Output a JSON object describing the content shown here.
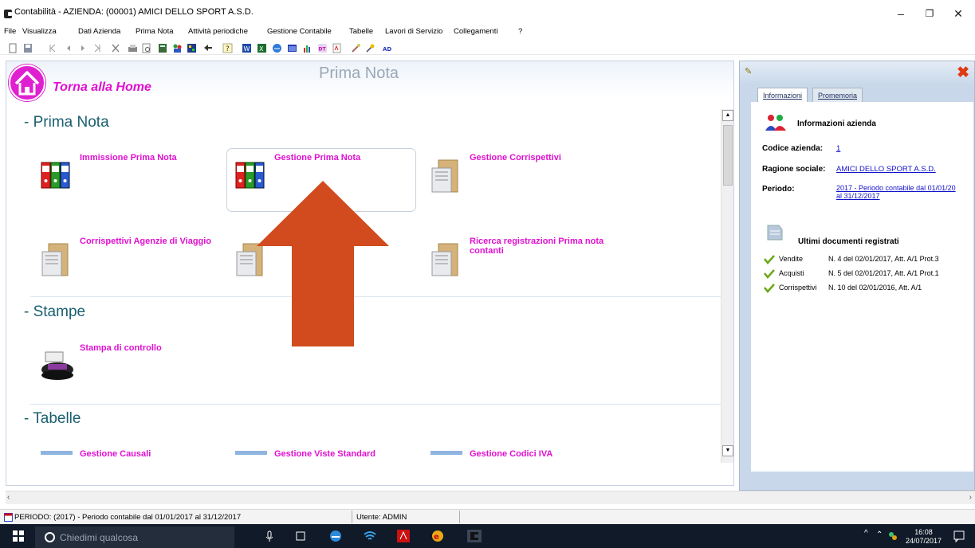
{
  "window": {
    "title": "Contabilità - AZIENDA: (00001) AMICI DELLO SPORT A.S.D.",
    "minimize_label": "–",
    "maximize_label": "❐",
    "close_label": "✕"
  },
  "menu": [
    "File",
    "Visualizza",
    "Dati Azienda",
    "Prima Nota",
    "Attività periodiche",
    "Gestione Contabile",
    "Tabelle",
    "Lavori di Servizio",
    "Collegamenti",
    "?"
  ],
  "toolbar": {
    "icons": [
      "new-icon",
      "save-icon",
      "first-record-icon",
      "prev-record-icon",
      "next-record-icon",
      "last-record-icon",
      "delete-icon",
      "print-icon",
      "print-preview-icon",
      "calculator-icon",
      "users-icon",
      "grid-icon",
      "pointer-icon",
      "help-icon",
      "word-icon",
      "excel-icon",
      "browser-icon",
      "window-icon",
      "chart-icon",
      "dt-icon",
      "pdf-icon",
      "tools-icon",
      "wizard-icon",
      "ad-icon"
    ],
    "ad_label": "AD",
    "dt_label": "DT"
  },
  "home": {
    "label": "Torna alla Home"
  },
  "page_title": "Prima Nota",
  "sections": [
    {
      "title": "- Prima Nota",
      "tiles": [
        {
          "label": "Immissione Prima Nota",
          "icon": "binders-icon"
        },
        {
          "label": "Gestione Prima Nota",
          "icon": "binders-icon",
          "selected": true
        },
        {
          "label": "Gestione Corrispettivi",
          "icon": "folder-icon"
        },
        {
          "label": "Corrispettivi Agenzie di Viaggio",
          "icon": "folder-icon"
        },
        {
          "label": "",
          "icon": "folder-icon"
        },
        {
          "label": "Ricerca registrazioni Prima nota contanti",
          "icon": "folder-icon"
        }
      ]
    },
    {
      "title": "- Stampe",
      "tiles": [
        {
          "label": "Stampa di controllo",
          "icon": "printer-icon"
        }
      ]
    },
    {
      "title": "- Tabelle",
      "tiles": [
        {
          "label": "Gestione Causali",
          "icon": "table-icon"
        },
        {
          "label": "Gestione Viste Standard",
          "icon": "table-icon"
        },
        {
          "label": "Gestione Codici IVA",
          "icon": "table-icon"
        }
      ]
    }
  ],
  "panel": {
    "tabs": [
      "Informazioni",
      "Promemoria"
    ],
    "info_title": "Informazioni azienda",
    "codice_label": "Codice azienda:",
    "codice_value": "1",
    "ragione_label": "Ragione sociale:",
    "ragione_value": "AMICI DELLO SPORT A.S.D.",
    "periodo_label": "Periodo:",
    "periodo_line1": "2017 - Periodo contabile dal 01/01/20",
    "periodo_line2": "al 31/12/2017",
    "docs_title": "Ultimi documenti registrati",
    "docs": [
      {
        "type": "Vendite",
        "desc": "N. 4 del 02/01/2017, Att. A/1 Prot.3"
      },
      {
        "type": "Acquisti",
        "desc": "N. 5 del 02/01/2017, Att. A/1 Prot.1"
      },
      {
        "type": "Corrispettivi",
        "desc": "N. 10 del 02/01/2016, Att. A/1"
      }
    ]
  },
  "statusbar": {
    "period": "PERIODO: (2017)  - Periodo contabile dal 01/01/2017 al 31/12/2017",
    "user": "Utente: ADMIN"
  },
  "taskbar": {
    "search_placeholder": "Chiedimi qualcosa",
    "time": "16:08",
    "date": "24/07/2017"
  },
  "colors": {
    "accent_magenta": "#e010d0",
    "section_teal": "#1a6070",
    "arrow_orange": "#d14b1f",
    "panel_blue": "#c8d8ea"
  }
}
